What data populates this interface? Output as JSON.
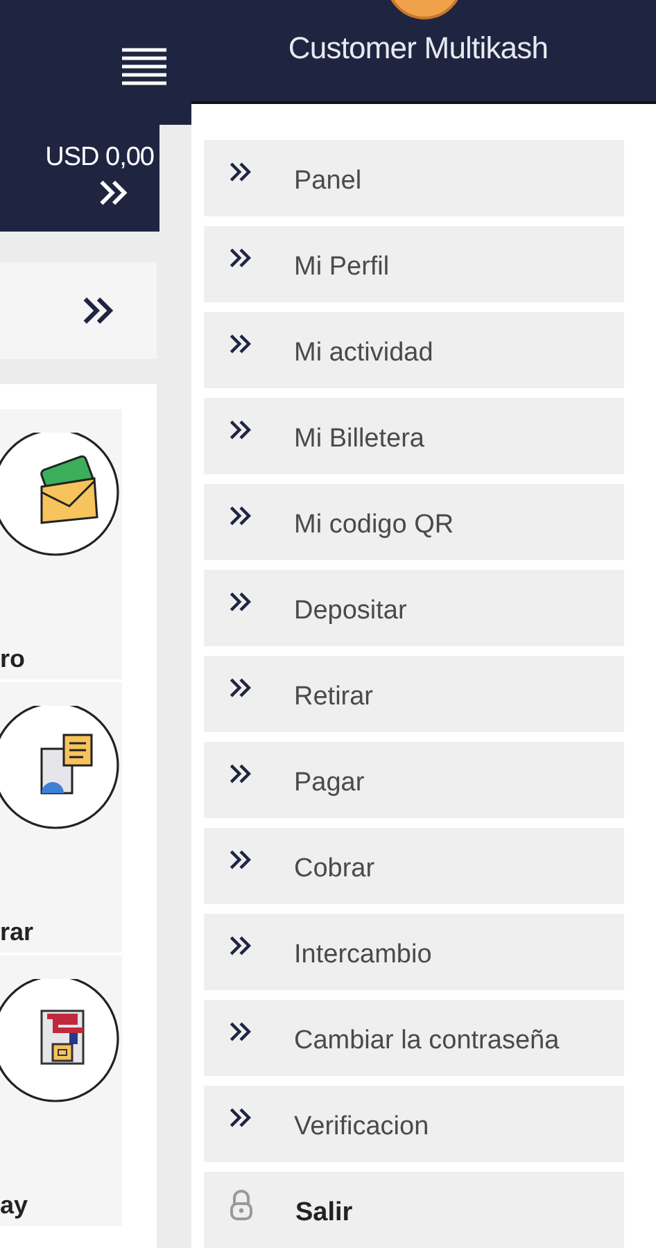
{
  "page": {
    "balance": "USD 0,00",
    "tiles": [
      {
        "label": "ro",
        "kind": "envelope"
      },
      {
        "label": "rar",
        "kind": "document"
      },
      {
        "label": "ay",
        "kind": "qr"
      }
    ]
  },
  "drawer": {
    "user_name": "Customer Multikash",
    "menu": [
      {
        "label": "Panel",
        "kind": "link"
      },
      {
        "label": "Mi Perfil",
        "kind": "link"
      },
      {
        "label": "Mi actividad",
        "kind": "link"
      },
      {
        "label": "Mi Billetera",
        "kind": "link"
      },
      {
        "label": "Mi codigo QR",
        "kind": "link"
      },
      {
        "label": "Depositar",
        "kind": "link"
      },
      {
        "label": "Retirar",
        "kind": "link"
      },
      {
        "label": "Pagar",
        "kind": "link"
      },
      {
        "label": "Cobrar",
        "kind": "link"
      },
      {
        "label": "Intercambio",
        "kind": "link"
      },
      {
        "label": "Cambiar la contraseña",
        "kind": "link"
      },
      {
        "label": "Verificacion",
        "kind": "link"
      },
      {
        "label": "Salir",
        "kind": "logout"
      }
    ]
  }
}
